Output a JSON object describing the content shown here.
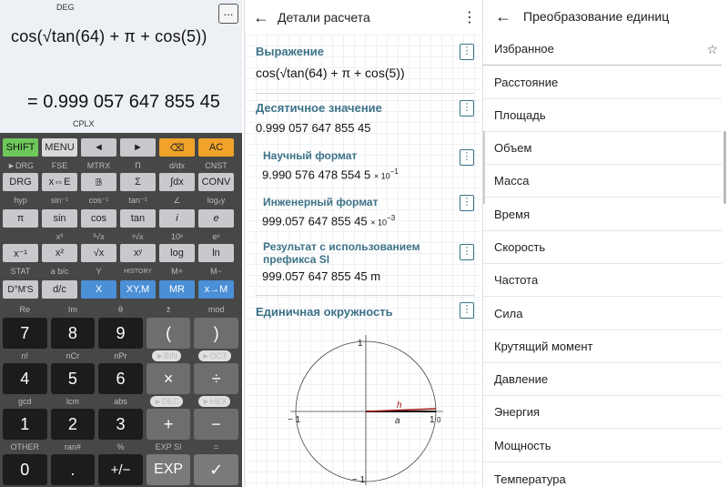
{
  "calculator": {
    "mode": "DEG",
    "more_label": "...",
    "expression": "cos(√tan(64) + π + cos(5))",
    "result": "= 0.999 057 647 855 45",
    "cplx": "CPLX",
    "row1": [
      "SHIFT",
      "MENU",
      "◄",
      "►",
      "⌫",
      "AC"
    ],
    "lbl2": [
      "►DRG",
      "FSE",
      "MTRX",
      "Π",
      "d/dx",
      "CNST"
    ],
    "row2": [
      "DRG",
      "x⇔E",
      "𝔹",
      "Σ",
      "∫dx",
      "CONV"
    ],
    "lbl3": [
      "hyp",
      "sin⁻¹",
      "cos⁻¹",
      "tan⁻¹",
      "∠",
      "logₓy"
    ],
    "row3": [
      "π",
      "sin",
      "cos",
      "tan",
      "i",
      "e"
    ],
    "lbl4": [
      "",
      "x³",
      "³√x",
      "ʸ√x",
      "10ˣ",
      "eˣ"
    ],
    "row4": [
      "x⁻¹",
      "x²",
      "√x",
      "xʸ",
      "log",
      "ln"
    ],
    "lbl5": [
      "STAT",
      "a b/c",
      "Y",
      "HISTORY",
      "M+",
      "M−"
    ],
    "row5": [
      "D°M'S",
      "d/c",
      "X",
      "XY,M",
      "MR",
      "x→M"
    ],
    "lbl6": [
      "Re",
      "Im",
      "θ",
      "z̄",
      "mod"
    ],
    "row6": [
      "7",
      "8",
      "9",
      "(",
      ")"
    ],
    "lbl7": [
      "n!",
      "nCr",
      "nPr",
      "►BIN",
      "►OCT"
    ],
    "row7": [
      "4",
      "5",
      "6",
      "×",
      "÷"
    ],
    "lbl8": [
      "gcd",
      "lcm",
      "abs",
      "►DEC",
      "►HEX"
    ],
    "row8": [
      "1",
      "2",
      "3",
      "+",
      "−"
    ],
    "lbl9": [
      "OTHER",
      "ran#",
      "%",
      "EXP SI",
      "="
    ],
    "row9": [
      "0",
      ".",
      "+/−",
      "EXP",
      "✓"
    ]
  },
  "details": {
    "title": "Детали расчета",
    "expression_label": "Выражение",
    "expression_value": "cos(√tan(64) + π + cos(5))",
    "decimal_label": "Десятичное значение",
    "decimal_value": "0.999 057 647 855 45",
    "sci_label": "Научный формат",
    "sci_value": "9.990 576 478 554 5",
    "sci_mult": "× 10",
    "sci_exp": "−1",
    "eng_label": "Инженерный формат",
    "eng_value": "999.057 647 855 45",
    "eng_mult": "× 10",
    "eng_exp": "−3",
    "si_label": "Результат с использованием префикса SI",
    "si_value": "999.057 647 855 45 m",
    "circle_label": "Единичная окружность",
    "axis_top": "1",
    "axis_bottom": "− 1",
    "axis_left": "− 1",
    "axis_right": "1",
    "origin": "0",
    "h": "h",
    "a": "a"
  },
  "units": {
    "title": "Преобразование единиц",
    "items": [
      "Избранное",
      "Расстояние",
      "Площадь",
      "Объем",
      "Масса",
      "Время",
      "Скорость",
      "Частота",
      "Сила",
      "Крутящий момент",
      "Давление",
      "Энергия",
      "Мощность",
      "Температура"
    ]
  }
}
